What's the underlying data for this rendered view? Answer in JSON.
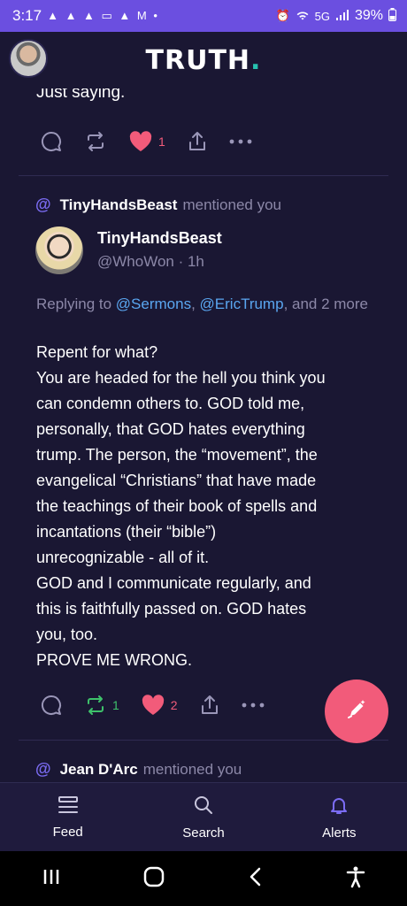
{
  "status_bar": {
    "time": "3:17",
    "notification_icons": "▲ ▲ ▲ ▭ ▲ M •",
    "network": "5G",
    "battery": "39%"
  },
  "header": {
    "logo_text": "TRUTH",
    "logo_dot": ".",
    "accent_color": "#27c2b0"
  },
  "previous_post": {
    "text": "Just saying.",
    "like_count": "1"
  },
  "notification": {
    "user": "TinyHandsBeast",
    "action": "mentioned you",
    "post": {
      "display_name": "TinyHandsBeast",
      "handle": "@WhoWon · 1h",
      "replying_prefix": "Replying to ",
      "reply_user_1": "@Sermons",
      "separator": ", ",
      "reply_user_2": "@EricTrump",
      "reply_suffix": ", and 2 more",
      "lines": [
        "Repent for what?",
        "You are headed for the hell you think you",
        "can condemn others to. GOD told me,",
        "personally, that GOD hates everything",
        "trump. The person, the “movement”, the",
        "evangelical “Christians” that have made",
        "the teachings of their book of spells and",
        "incantations (their “bible”)",
        "unrecognizable - all of it.",
        "GOD and I communicate regularly, and",
        "this is faithfully passed on. GOD hates",
        "you, too.",
        "PROVE ME WRONG."
      ],
      "retruth_count": "1",
      "like_count": "2"
    }
  },
  "next_notification": {
    "user": "Jean D'Arc",
    "action": "mentioned you"
  },
  "bottom_nav": {
    "feed": "Feed",
    "search": "Search",
    "alerts": "Alerts"
  },
  "colors": {
    "background": "#1a1733",
    "like_pink": "#f25b7a",
    "retruth_green": "#3ec26b",
    "link_blue": "#5aa6f0",
    "at_purple": "#7b6cf3",
    "status_bar": "#6b4fe0"
  }
}
